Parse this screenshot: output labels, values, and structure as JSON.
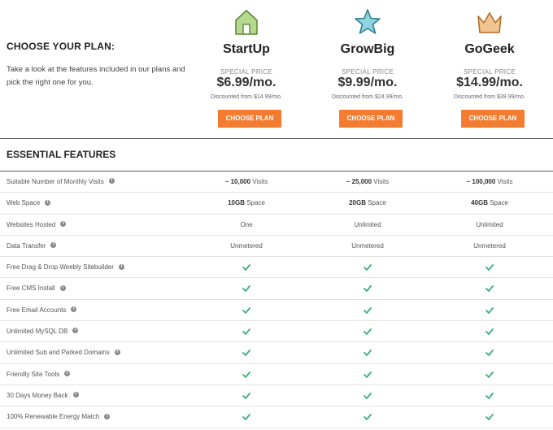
{
  "intro": {
    "title": "CHOOSE YOUR PLAN:",
    "text": "Take a look at the features included in our plans and pick the right one for you."
  },
  "colors": {
    "button": "#f47c30",
    "check": "#3bb077",
    "startup_icon": "#b7d88f",
    "growbig_icon": "#8fd4e0",
    "gogeek_icon": "#f2c48f"
  },
  "plans": [
    {
      "name": "StartUp",
      "icon": "house-icon",
      "special": "SPECIAL PRICE",
      "price": "$6.99/mo.",
      "discount": "Discounted from $14.99/mo.",
      "button": "CHOOSE PLAN"
    },
    {
      "name": "GrowBig",
      "icon": "star-icon",
      "special": "SPECIAL PRICE",
      "price": "$9.99/mo.",
      "discount": "Discounted from $24.99/mo.",
      "button": "CHOOSE PLAN"
    },
    {
      "name": "GoGeek",
      "icon": "crown-icon",
      "special": "SPECIAL PRICE",
      "price": "$14.99/mo.",
      "discount": "Discounted from $39.99/mo.",
      "button": "CHOOSE PLAN"
    }
  ],
  "features_title": "ESSENTIAL FEATURES",
  "features": [
    {
      "label": "Suitable Number of Monthly Visits",
      "values": [
        {
          "bold": "~ 10,000",
          "rest": " Visits"
        },
        {
          "bold": "~ 25,000",
          "rest": " Visits"
        },
        {
          "bold": "~ 100,000",
          "rest": " Visits"
        }
      ]
    },
    {
      "label": "Web Space",
      "values": [
        {
          "bold": "10GB",
          "rest": " Space"
        },
        {
          "bold": "20GB",
          "rest": " Space"
        },
        {
          "bold": "40GB",
          "rest": " Space"
        }
      ]
    },
    {
      "label": "Websites Hosted",
      "values": [
        {
          "bold": "",
          "rest": "One"
        },
        {
          "bold": "",
          "rest": "Unlimited"
        },
        {
          "bold": "",
          "rest": "Unlimited"
        }
      ]
    },
    {
      "label": "Data Transfer",
      "values": [
        {
          "bold": "",
          "rest": "Unmetered"
        },
        {
          "bold": "",
          "rest": "Unmetered"
        },
        {
          "bold": "",
          "rest": "Unmetered"
        }
      ]
    },
    {
      "label": "Free Drag & Drop Weebly Sitebuilder",
      "check": true
    },
    {
      "label": "Free CMS Install",
      "check": true
    },
    {
      "label": "Free Email Accounts",
      "check": true
    },
    {
      "label": "Unlimited MySQL DB",
      "check": true
    },
    {
      "label": "Unlimited Sub and Parked Domains",
      "check": true
    },
    {
      "label": "Friendly Site Tools",
      "check": true
    },
    {
      "label": "30 Days Money Back",
      "check": true
    },
    {
      "label": "100% Renewable Energy Match",
      "check": true
    }
  ]
}
